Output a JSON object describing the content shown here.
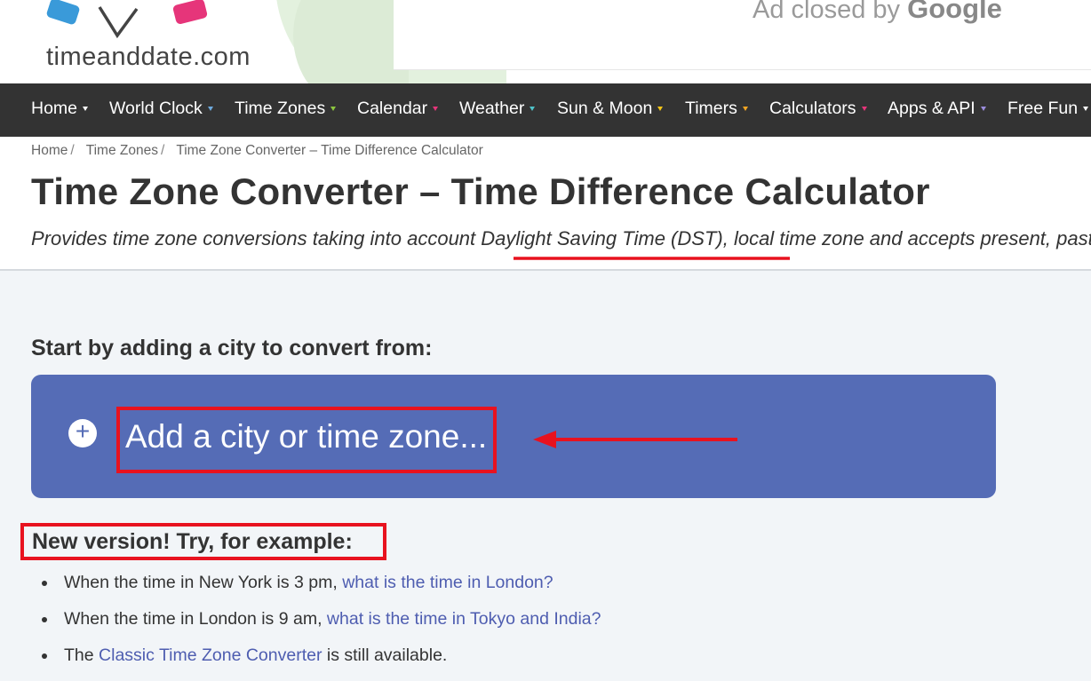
{
  "header": {
    "logo_text": "timeanddate.com",
    "ad_text": "Ad closed by",
    "ad_brand": "Google"
  },
  "nav": {
    "items": [
      {
        "label": "Home",
        "tri_color": "#ffffff"
      },
      {
        "label": "World Clock",
        "tri_color": "#6ea9dc"
      },
      {
        "label": "Time Zones",
        "tri_color": "#8cc63f"
      },
      {
        "label": "Calendar",
        "tri_color": "#e6357a"
      },
      {
        "label": "Weather",
        "tri_color": "#4fc3c9"
      },
      {
        "label": "Sun & Moon",
        "tri_color": "#f5c518"
      },
      {
        "label": "Timers",
        "tri_color": "#f5a623"
      },
      {
        "label": "Calculators",
        "tri_color": "#e6357a"
      },
      {
        "label": "Apps & API",
        "tri_color": "#9b8ddc"
      },
      {
        "label": "Free Fun",
        "tri_color": "#ffffff"
      }
    ]
  },
  "breadcrumb": {
    "items": [
      "Home",
      "Time Zones",
      "Time Zone Converter – Time Difference Calculator"
    ],
    "separator": "/"
  },
  "page": {
    "title": "Time Zone Converter – Time Difference Calculator",
    "subtitle_pre": "Provides time zone conversions taking into account ",
    "subtitle_dst": "Daylight Saving Time (DST),",
    "subtitle_post": " local time zone and accepts present, past, or future dates."
  },
  "converter": {
    "start_label": "Start by adding a city to convert from:",
    "input_placeholder": "Add a city or time zone...",
    "box_color": "#556cb6"
  },
  "examples": {
    "heading": "New version! Try, for example:",
    "items": [
      {
        "pre": "When the time in New York is 3 pm, ",
        "link": "what is the time in London?",
        "post": ""
      },
      {
        "pre": "When the time in London is 9 am, ",
        "link": "what is the time in Tokyo and India?",
        "post": ""
      },
      {
        "pre": "The ",
        "link": "Classic Time Zone Converter",
        "post": " is still available."
      }
    ]
  },
  "annotation_color": "#e8121f"
}
